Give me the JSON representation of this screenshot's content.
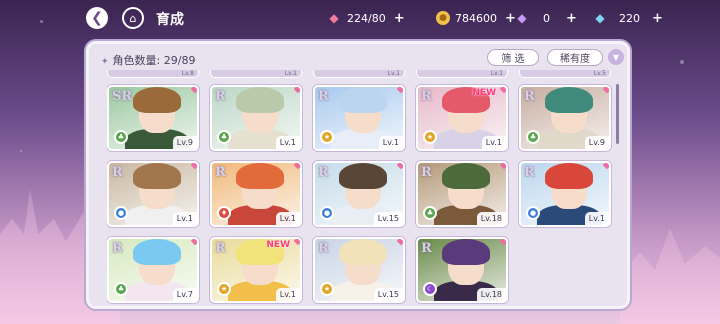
{
  "header": {
    "title": "育成",
    "back_icon": "back-arrow-icon",
    "home_icon": "home-icon"
  },
  "resources": {
    "candy": "224/80",
    "coin": "784600",
    "gem_purple": "0",
    "gem_blue": "220",
    "plus": "+"
  },
  "panel": {
    "count_label": "角色数量: 29/89",
    "filter_label": "筛 选",
    "rarity_label": "稀有度",
    "partial_row_levels": [
      "Lv.8",
      "Lv.1",
      "Lv.1",
      "Lv.1",
      "Lv.5"
    ]
  },
  "colors": {
    "pin": "#f06ba0",
    "new": "#ff3a7a",
    "panel_bg": "#e8e3ee"
  },
  "cards": [
    {
      "rarity": "SR",
      "level": "Lv.9",
      "new": false,
      "hair": "#9a6a3a",
      "outfit": "#3a5a3a",
      "bg": "#9cc7a0",
      "elem": "#5aa64f",
      "elem_icon": "leaf-icon"
    },
    {
      "rarity": "R",
      "level": "Lv.1",
      "new": false,
      "hair": "#b9c9a9",
      "outfit": "#e6e0d0",
      "bg": "#bcd7c8",
      "elem": "#5aa64f",
      "elem_icon": "leaf-icon"
    },
    {
      "rarity": "R",
      "level": "Lv.1",
      "new": false,
      "hair": "#bcd4ef",
      "outfit": "#e8eef8",
      "bg": "#a9c9ee",
      "elem": "#e0a524",
      "elem_icon": "star-icon"
    },
    {
      "rarity": "R",
      "level": "Lv.1",
      "new": true,
      "hair": "#e55a6a",
      "outfit": "#d9d1e6",
      "bg": "#e6b9c9",
      "elem": "#e0a524",
      "elem_icon": "star-icon"
    },
    {
      "rarity": "R",
      "level": "Lv.9",
      "new": false,
      "hair": "#3f8a7a",
      "outfit": "#e0d9c9",
      "bg": "#c7ada1",
      "elem": "#5aa64f",
      "elem_icon": "leaf-icon"
    },
    {
      "rarity": "R",
      "level": "Lv.1",
      "new": false,
      "hair": "#a1764d",
      "outfit": "#f0f0f0",
      "bg": "#c9b8a1",
      "elem": "#3f7fd9",
      "elem_icon": "drop-icon"
    },
    {
      "rarity": "R",
      "level": "Lv.1",
      "new": false,
      "hair": "#e36a3a",
      "outfit": "#c9463a",
      "bg": "#f0b97a",
      "elem": "#e0483a",
      "elem_icon": "flame-icon"
    },
    {
      "rarity": "R",
      "level": "Lv.15",
      "new": false,
      "hair": "#5a4636",
      "outfit": "#e9eef5",
      "bg": "#c5dbe9",
      "elem": "#3f7fd9",
      "elem_icon": "drop-icon"
    },
    {
      "rarity": "R",
      "level": "Lv.18",
      "new": false,
      "hair": "#4c6a3a",
      "outfit": "#7a5a3a",
      "bg": "#b59a7a",
      "elem": "#5aa64f",
      "elem_icon": "leaf-icon"
    },
    {
      "rarity": "R",
      "level": "Lv.1",
      "new": false,
      "hair": "#d9463a",
      "outfit": "#2a4a7a",
      "bg": "#bcd6ee",
      "elem": "#3f7fd9",
      "elem_icon": "drop-icon"
    },
    {
      "rarity": "R",
      "level": "Lv.7",
      "new": false,
      "hair": "#7ac9f0",
      "outfit": "#f3e6f0",
      "bg": "#d7e9c0",
      "elem": "#5aa64f",
      "elem_icon": "leaf-icon"
    },
    {
      "rarity": "R",
      "level": "Lv.1",
      "new": true,
      "hair": "#f2e27a",
      "outfit": "#f2c04a",
      "bg": "#eadb9a",
      "elem": "#e0a524",
      "elem_icon": "star-icon"
    },
    {
      "rarity": "R",
      "level": "Lv.15",
      "new": false,
      "hair": "#f1e2b9",
      "outfit": "#f6f2ea",
      "bg": "#c9d4e6",
      "elem": "#e0a524",
      "elem_icon": "star-icon"
    },
    {
      "rarity": "R",
      "level": "Lv.18",
      "new": false,
      "hair": "#5a3a7a",
      "outfit": "#3a2a4a",
      "bg": "#6a8a4a",
      "elem": "#8a4ac9",
      "elem_icon": "moon-icon"
    }
  ]
}
